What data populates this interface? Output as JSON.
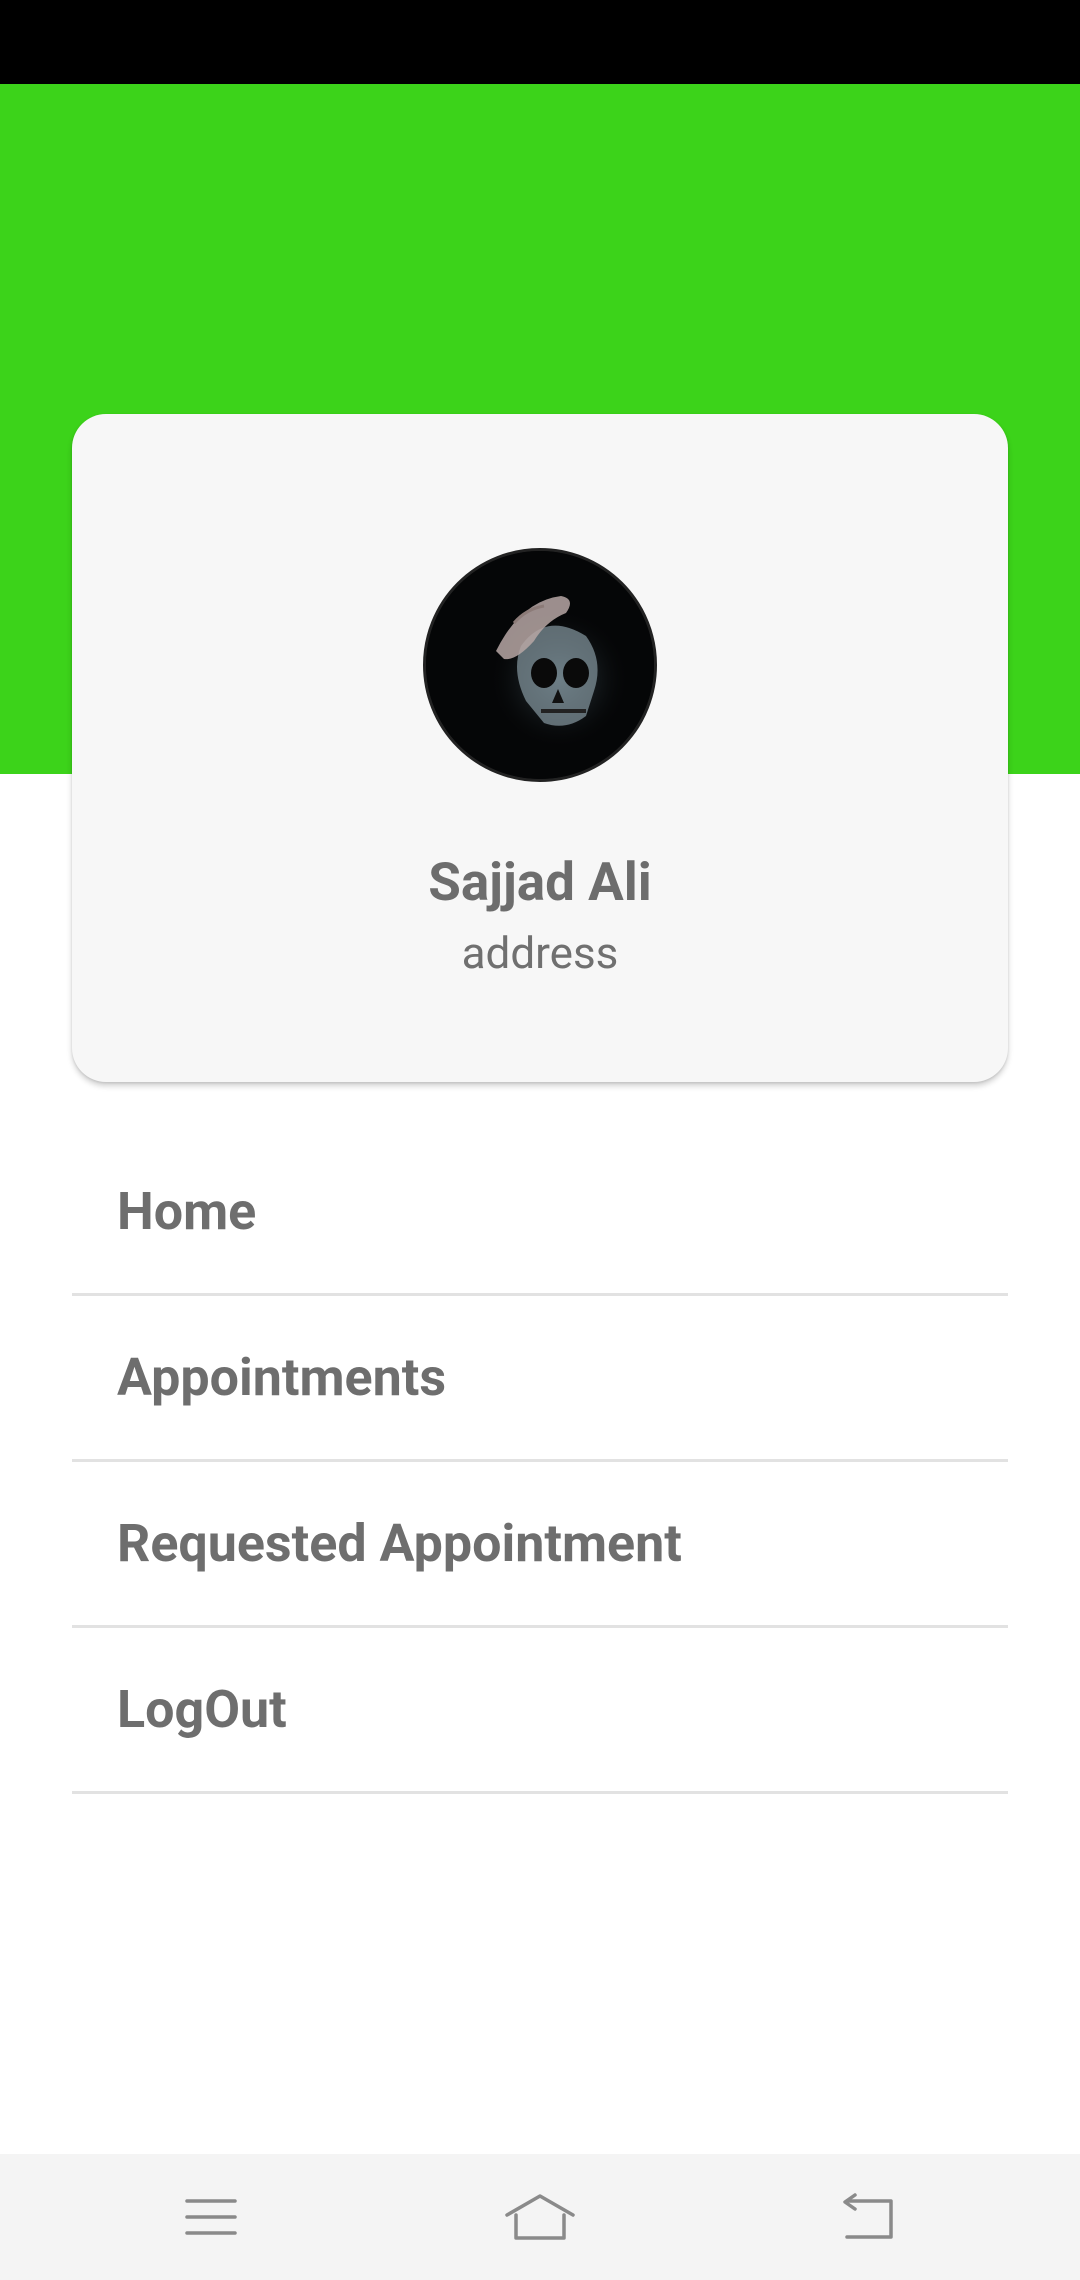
{
  "profile": {
    "name": "Sajjad Ali",
    "address": "address"
  },
  "menu": {
    "items": [
      {
        "label": "Home"
      },
      {
        "label": "Appointments"
      },
      {
        "label": "Requested Appointment"
      },
      {
        "label": "LogOut"
      }
    ]
  },
  "nav": {
    "icons": [
      "menu-icon",
      "home-icon",
      "back-icon"
    ]
  },
  "colors": {
    "header": "#3cd31a",
    "status_bar": "#000000",
    "card": "#f7f7f7",
    "text": "#6e6e6e",
    "nav_bar": "#f4f4f4"
  }
}
